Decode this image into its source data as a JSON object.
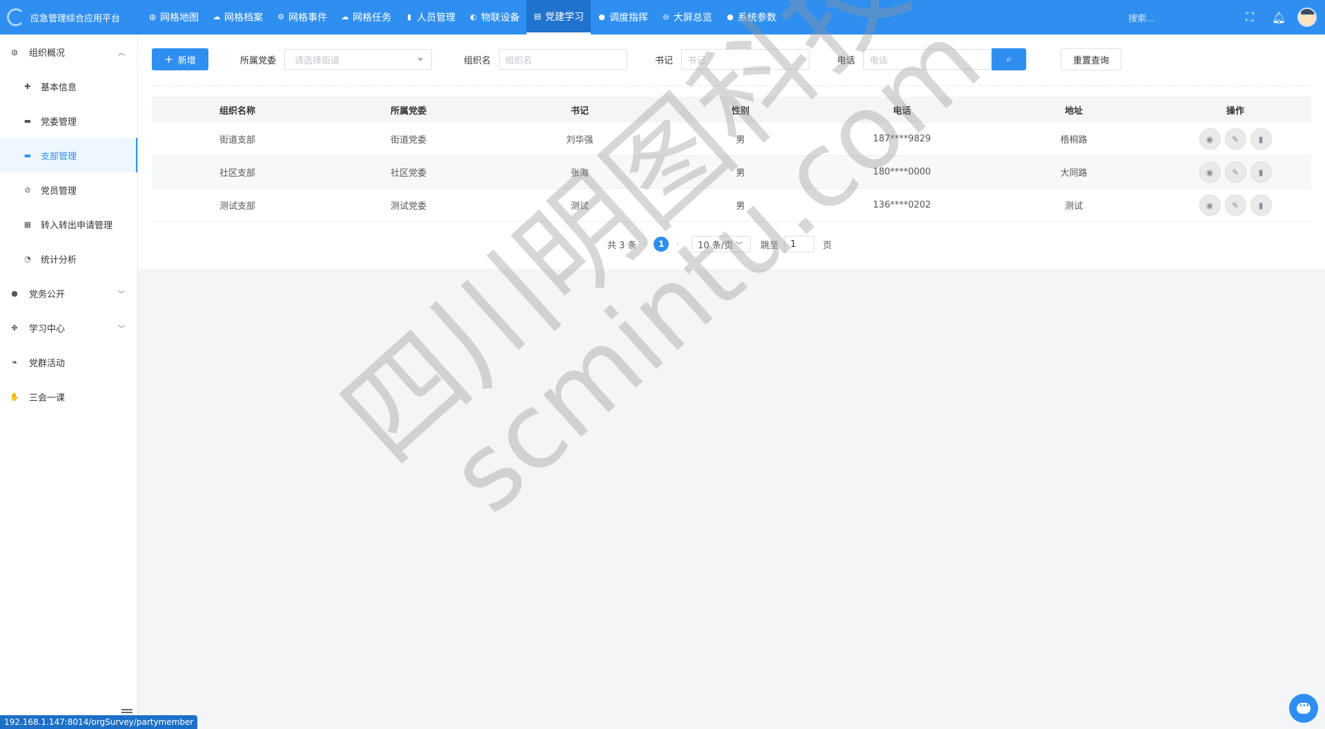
{
  "app": {
    "title": "应急管理综合应用平台"
  },
  "nav": {
    "items": [
      {
        "label": "网格地图",
        "icon": "globe-icon"
      },
      {
        "label": "网格档案",
        "icon": "cloud-icon"
      },
      {
        "label": "网格事件",
        "icon": "gear-icon"
      },
      {
        "label": "网格任务",
        "icon": "cloud-icon"
      },
      {
        "label": "人员管理",
        "icon": "file-icon"
      },
      {
        "label": "物联设备",
        "icon": "ball-icon"
      },
      {
        "label": "党建学习",
        "icon": "book-icon",
        "active": true
      },
      {
        "label": "调度指挥",
        "icon": "dot-icon"
      },
      {
        "label": "大屏总览",
        "icon": "minus-circle-icon"
      },
      {
        "label": "系统参数",
        "icon": "dot-icon"
      }
    ]
  },
  "header": {
    "search_placeholder": "搜索..."
  },
  "sidebar": {
    "groups": [
      {
        "label": "组织概况",
        "expanded": true,
        "icon": "globe-icon"
      },
      {
        "label": "党务公开",
        "expanded": false,
        "icon": "chat-icon"
      },
      {
        "label": "学习中心",
        "expanded": false,
        "icon": "cubes-icon"
      },
      {
        "label": "党群活动",
        "expanded": false,
        "icon": "leaf-icon"
      },
      {
        "label": "三会一课",
        "expanded": false,
        "icon": "thumb-icon"
      }
    ],
    "sub_items": [
      {
        "label": "基本信息",
        "icon": "puzzle-icon"
      },
      {
        "label": "党委管理",
        "icon": "bed-icon"
      },
      {
        "label": "支部管理",
        "icon": "card-icon",
        "active": true
      },
      {
        "label": "党员管理",
        "icon": "ban-icon"
      },
      {
        "label": "转入转出申请管理",
        "icon": "calendar-icon"
      },
      {
        "label": "统计分析",
        "icon": "pie-icon"
      }
    ]
  },
  "toolbar": {
    "add_label": "新增",
    "party_committee_label": "所属党委",
    "party_committee_placeholder": "请选择街道",
    "org_name_label": "组织名",
    "org_name_placeholder": "组织名",
    "secretary_label": "书记",
    "secretary_placeholder": "书记",
    "phone_label": "电话",
    "phone_placeholder": "电话",
    "reset_label": "重置查询"
  },
  "table": {
    "columns": [
      "组织名称",
      "所属党委",
      "书记",
      "性别",
      "电话",
      "地址",
      "操作"
    ],
    "rows": [
      [
        "街道支部",
        "街道党委",
        "刘华强",
        "男",
        "187****9829",
        "梧桐路"
      ],
      [
        "社区支部",
        "社区党委",
        "张海",
        "男",
        "180****0000",
        "大同路"
      ],
      [
        "测试支部",
        "测试党委",
        "测试",
        "男",
        "136****0202",
        "测试"
      ]
    ]
  },
  "pager": {
    "total_text": "共 3 条",
    "current_page": "1",
    "page_size": "10 条/页",
    "goto_label": "跳至",
    "goto_value": "1",
    "page_suffix": "页"
  },
  "watermark": {
    "line1": "四川明图科技",
    "line2": "scmintu.com"
  },
  "status_bar": {
    "url": "192.168.1.147:8014/orgSurvey/partymember"
  },
  "colors": {
    "primary": "#2f8ff0",
    "active_nav": "#1f73cc"
  }
}
